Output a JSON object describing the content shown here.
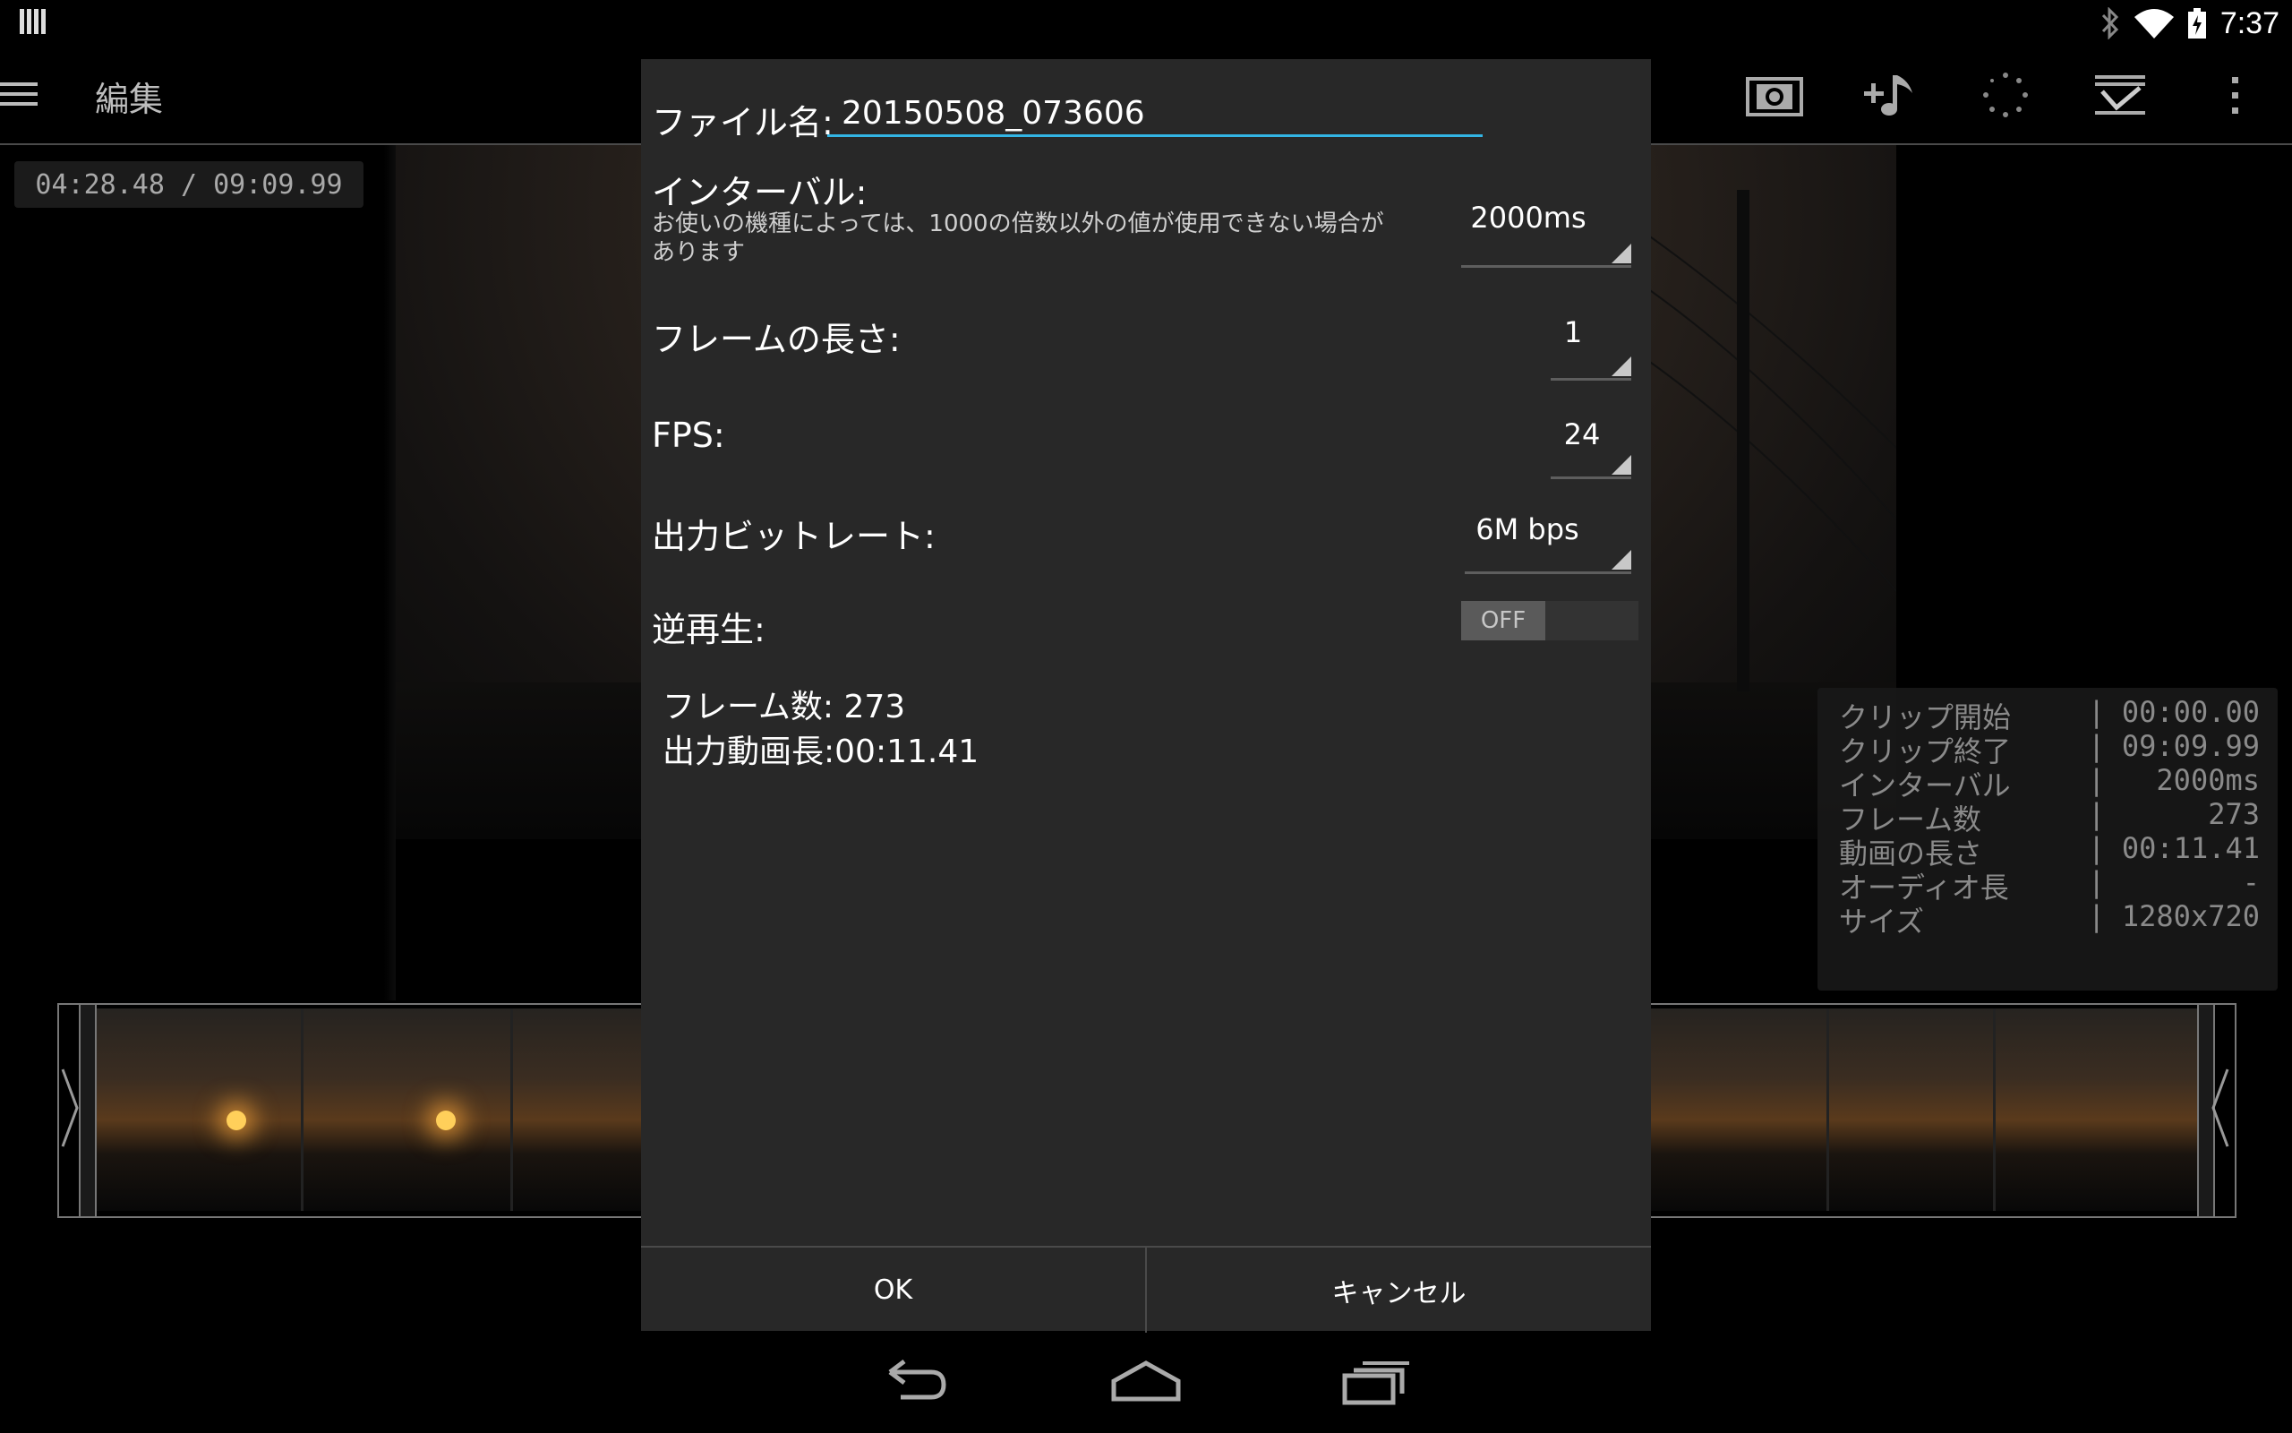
{
  "status_bar": {
    "time": "7:37",
    "icons": [
      "notification-icon",
      "bluetooth-icon",
      "wifi-icon",
      "battery-icon"
    ]
  },
  "action_bar": {
    "title": "編集",
    "icons": [
      "menu-icon",
      "camera-icon",
      "add-music-icon",
      "loading-icon",
      "export-icon",
      "overflow-menu-icon"
    ]
  },
  "preview": {
    "timestamp": "04:28.48 / 09:09.99"
  },
  "info_panel": {
    "rows": [
      {
        "label": "クリップ開始",
        "sep": "|",
        "value": "00:00.00"
      },
      {
        "label": "クリップ終了",
        "sep": "|",
        "value": "09:09.99"
      },
      {
        "label": "インターバル",
        "sep": "|",
        "value": "2000ms"
      },
      {
        "label": "フレーム数",
        "sep": "|",
        "value": "273"
      },
      {
        "label": "動画の長さ",
        "sep": "|",
        "value": "00:11.41"
      },
      {
        "label": "オーディオ長",
        "sep": "|",
        "value": "-"
      },
      {
        "label": "サイズ",
        "sep": "|",
        "value": "1280x720"
      }
    ]
  },
  "dialog": {
    "filename_label": "ファイル名:",
    "filename_value": "20150508_073606",
    "interval_label": "インターバル:",
    "interval_note_line1": "お使いの機種によっては、1000の倍数以外の値が使用できない場合が",
    "interval_note_line2": "あります",
    "interval_value": "2000ms",
    "frame_length_label": "フレームの長さ:",
    "frame_length_value": "1",
    "fps_label": "FPS:",
    "fps_value": "24",
    "bitrate_label": "出力ビットレート:",
    "bitrate_value": "6M bps",
    "reverse_label": "逆再生:",
    "reverse_value": "OFF",
    "frame_count": "フレーム数: 273",
    "output_length": "出力動画長:00:11.41",
    "ok_label": "OK",
    "cancel_label": "キャンセル"
  },
  "nav_bar": {
    "icons": [
      "back-icon",
      "home-icon",
      "recent-apps-icon"
    ]
  }
}
